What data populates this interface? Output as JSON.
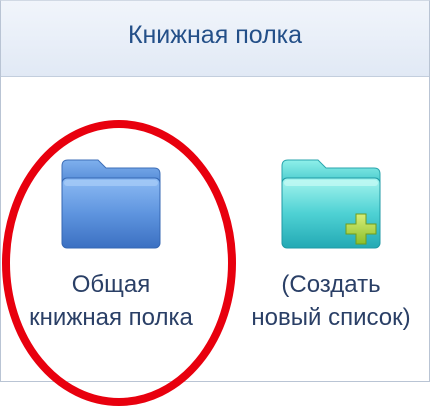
{
  "panel": {
    "title": "Книжная полка"
  },
  "items": [
    {
      "icon": "folder-blue-icon",
      "line1": "Общая",
      "line2": "книжная полка"
    },
    {
      "icon": "folder-add-icon",
      "line1": "(Создать",
      "line2": "новый список)"
    }
  ],
  "colors": {
    "title_text": "#234f88",
    "header_bg": "#e1e9f5",
    "highlight": "#e8000e",
    "folder_blue": "#5f95df",
    "folder_teal": "#3ec8d6",
    "plus_green": "#a9d44a"
  }
}
